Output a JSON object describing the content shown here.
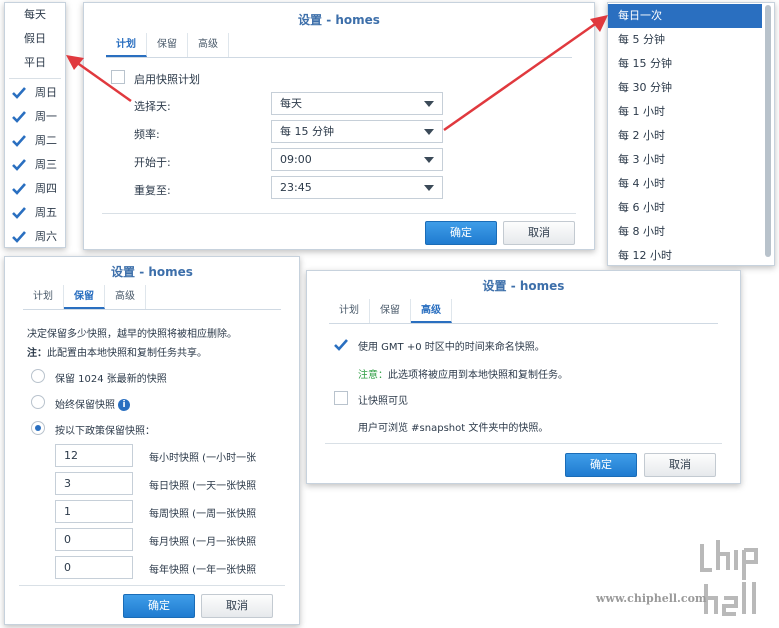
{
  "days_menu": {
    "options": [
      "每天",
      "假日",
      "平日"
    ],
    "checked_days": [
      "周日",
      "周一",
      "周二",
      "周三",
      "周四",
      "周五",
      "周六"
    ]
  },
  "dlg1": {
    "title": "设置 - homes",
    "tabs": [
      "计划",
      "保留",
      "高级"
    ],
    "enable_label": "启用快照计划",
    "rows": [
      {
        "label": "选择天:",
        "value": "每天"
      },
      {
        "label": "频率:",
        "value": "每 15 分钟"
      },
      {
        "label": "开始于:",
        "value": "09:00"
      },
      {
        "label": "重复至:",
        "value": "23:45"
      }
    ],
    "ok": "确定",
    "cancel": "取消"
  },
  "freq_menu": {
    "items": [
      "每日一次",
      "每 5 分钟",
      "每 15 分钟",
      "每 30 分钟",
      "每 1 小时",
      "每 2 小时",
      "每 3 小时",
      "每 4 小时",
      "每 6 小时",
      "每 8 小时",
      "每 12 小时"
    ],
    "selected": "每日一次"
  },
  "dlg2": {
    "title": "设置 - homes",
    "tabs": [
      "计划",
      "保留",
      "高级"
    ],
    "desc": "决定保留多少快照，越早的快照将被相应删除。",
    "note_prefix": "注：",
    "note_text": "此配置由本地快照和复制任务共享。",
    "opt1": "保留 1024 张最新的快照",
    "opt2": "始终保留快照",
    "opt3": "按以下政策保留快照：",
    "policies": [
      {
        "value": "12",
        "label": "每小时快照 (一小时一张"
      },
      {
        "value": "3",
        "label": "每日快照 (一天一张快照"
      },
      {
        "value": "1",
        "label": "每周快照 (一周一张快照"
      },
      {
        "value": "0",
        "label": "每月快照 (一月一张快照"
      },
      {
        "value": "0",
        "label": "每年快照 (一年一张快照"
      }
    ],
    "ok": "确定",
    "cancel": "取消"
  },
  "dlg3": {
    "title": "设置 - homes",
    "tabs": [
      "计划",
      "保留",
      "高级"
    ],
    "gmt_label": "使用 GMT +0 时区中的时间来命名快照。",
    "note_prefix": "注意：",
    "note_text": "此选项将被应用到本地快照和复制任务。",
    "visible_label": "让快照可见",
    "visible_desc": "用户可浏览 #snapshot 文件夹中的快照。",
    "ok": "确定",
    "cancel": "取消"
  },
  "watermark": {
    "logo_text": "chiphell",
    "url": "www.chiphell.com"
  },
  "colors": {
    "accent": "#2a6fc0",
    "arrow": "#e0393e",
    "note_green": "#2f9e44"
  }
}
